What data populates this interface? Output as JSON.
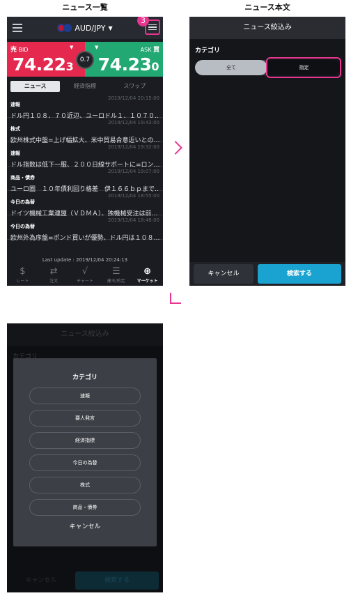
{
  "captions": {
    "left": "ニュース一覧",
    "right": "ニュース本文"
  },
  "screen1": {
    "step_badge": "3",
    "pair": "AUD/JPY",
    "bid": {
      "label": "売",
      "sub": "BID",
      "big": "74.22",
      "pip": "3"
    },
    "ask": {
      "label": "買",
      "sub": "ASK",
      "big": "74.23",
      "pip": "0"
    },
    "spread": "0.7",
    "tabs": [
      "ニュース",
      "経済指標",
      "スワップ"
    ],
    "news": [
      {
        "category": "速報",
        "time": "2019/12/04 20:15:00",
        "title": "ドル円１０８．７０近辺、ユーロドル１．１０７０…"
      },
      {
        "category": "株式",
        "time": "2019/12/04 19:43:00",
        "title": "欧州株式中盤=上げ幅拡大、米中貿易合意近いとの…"
      },
      {
        "category": "速報",
        "time": "2019/12/04 19:32:00",
        "title": "ドル指数は低下一服、２００日線サポートに=ロン…"
      },
      {
        "category": "商品・債券",
        "time": "2019/12/04 19:07:00",
        "title": "ユーロ圏　１０年債利回り格差　伊１６６ｂｐまで…"
      },
      {
        "category": "今日の為替",
        "time": "2019/12/04 18:55:00",
        "title": "ドイツ機械工業連盟（ＶＤＭＡ）、独機械受注は前…"
      },
      {
        "category": "今日の為替",
        "time": "2019/12/04 18:48:00",
        "title": "欧州外為序盤=ポンド買いが優勢、ドル円は１０８…"
      }
    ],
    "last_update": "Last update : 2019/12/04 20:24:13",
    "tabbar": [
      {
        "icon": "rate-icon",
        "glyph": "$",
        "label": "レート"
      },
      {
        "icon": "order-icon",
        "glyph": "⇄",
        "label": "注文"
      },
      {
        "icon": "chart-icon",
        "glyph": "√",
        "label": "チャート"
      },
      {
        "icon": "position-icon",
        "glyph": "☰",
        "label": "建玉/約定"
      },
      {
        "icon": "globe-icon",
        "glyph": "⊕",
        "label": "マーケット"
      }
    ]
  },
  "screen2": {
    "header": "ニュース絞込み",
    "category_label": "カテゴリ",
    "seg_all": "全て",
    "seg_specify": "指定",
    "cancel": "キャンセル",
    "search": "検索する"
  },
  "screen3": {
    "bg_header": "ニュース絞込み",
    "bg_label": "カテゴリ",
    "sheet_title": "カテゴリ",
    "options": [
      "速報",
      "要人発言",
      "経済指標",
      "今日の為替",
      "株式",
      "商品・債券"
    ],
    "cancel": "キャンセル",
    "bg_cancel": "キャンセル",
    "bg_search": "検索する"
  },
  "colors": {
    "accent": "#e8358f",
    "bid": "#e4284e",
    "ask": "#22a873",
    "search": "#1aa3d0"
  }
}
